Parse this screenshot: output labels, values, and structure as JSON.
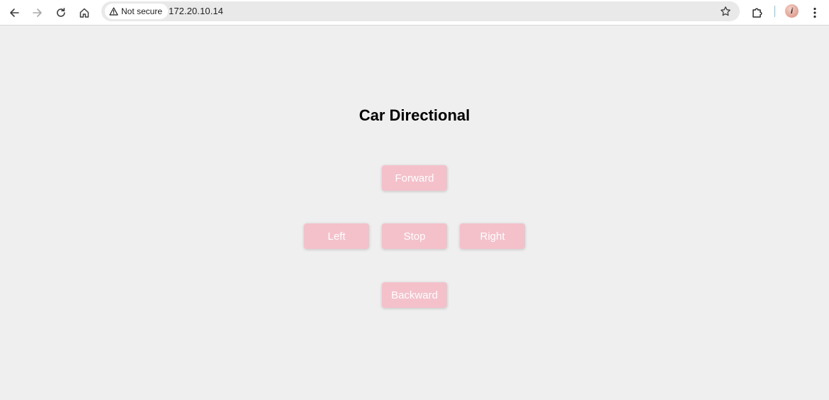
{
  "browser": {
    "security_label": "Not secure",
    "url": "172.20.10.14",
    "avatar_letter": "i",
    "icons": {
      "back": "back-arrow-icon",
      "forward": "forward-arrow-icon",
      "reload": "reload-icon",
      "home": "home-icon",
      "warning": "warning-triangle-icon",
      "bookmark": "star-icon",
      "extensions": "puzzle-icon",
      "menu": "kebab-menu-icon"
    }
  },
  "page": {
    "title": "Car Directional",
    "buttons": {
      "forward": "Forward",
      "left": "Left",
      "stop": "Stop",
      "right": "Right",
      "backward": "Backward"
    },
    "colors": {
      "background": "#efefef",
      "button_bg": "#f4c1cb",
      "button_text": "#ffffff"
    }
  }
}
